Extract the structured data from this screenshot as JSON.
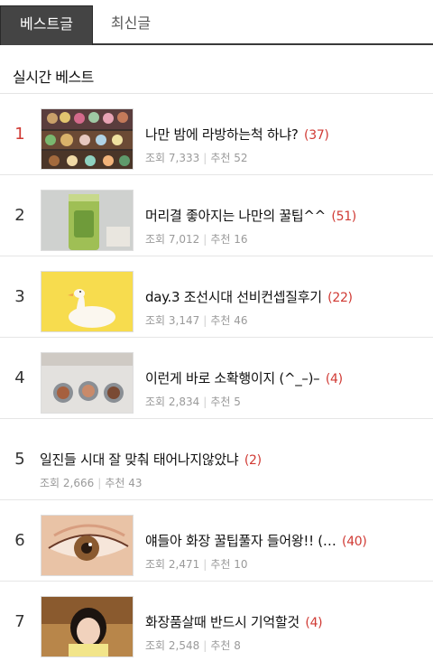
{
  "tabs": [
    {
      "label": "베스트글",
      "active": true
    },
    {
      "label": "최신글",
      "active": false
    }
  ],
  "section_title": "실시간 베스트",
  "posts": [
    {
      "rank": "1",
      "title": "나만 밤에 라방하는척 하냐?",
      "comments": "(37)",
      "views_label": "조회",
      "views": "7,333",
      "likes_label": "추천",
      "likes": "52",
      "thumbnail": "shop-display"
    },
    {
      "rank": "2",
      "title": "머리결 좋아지는 나만의 꿀팁^^",
      "comments": "(51)",
      "views_label": "조회",
      "views": "7,012",
      "likes_label": "추천",
      "likes": "16",
      "thumbnail": "green-tube"
    },
    {
      "rank": "3",
      "title": "day.3 조선시대 선비컨셉질후기",
      "comments": "(22)",
      "views_label": "조회",
      "views": "3,147",
      "likes_label": "추천",
      "likes": "46",
      "thumbnail": "duck"
    },
    {
      "rank": "4",
      "title": "이런게 바로 소확행이지 (^_–)–",
      "comments": "(4)",
      "views_label": "조회",
      "views": "2,834",
      "likes_label": "추천",
      "likes": "5",
      "thumbnail": "eyeshadow"
    },
    {
      "rank": "5",
      "title": "일진들 시대 잘 맞춰 태어나지않았냐",
      "comments": "(2)",
      "views_label": "조회",
      "views": "2,666",
      "likes_label": "추천",
      "likes": "43",
      "thumbnail": ""
    },
    {
      "rank": "6",
      "title": "얘들아 화장 꿀팁풀자 들어왕!! (…",
      "comments": "(40)",
      "views_label": "조회",
      "views": "2,471",
      "likes_label": "추천",
      "likes": "10",
      "thumbnail": "eye-makeup"
    },
    {
      "rank": "7",
      "title": "화장품살때 반드시 기억할것",
      "comments": "(4)",
      "views_label": "조회",
      "views": "2,548",
      "likes_label": "추천",
      "likes": "8",
      "thumbnail": "girl-portrait"
    }
  ],
  "colors": {
    "accent_red": "#d03a34",
    "tab_active_bg": "#444444",
    "meta_gray": "#9a9a9a"
  }
}
